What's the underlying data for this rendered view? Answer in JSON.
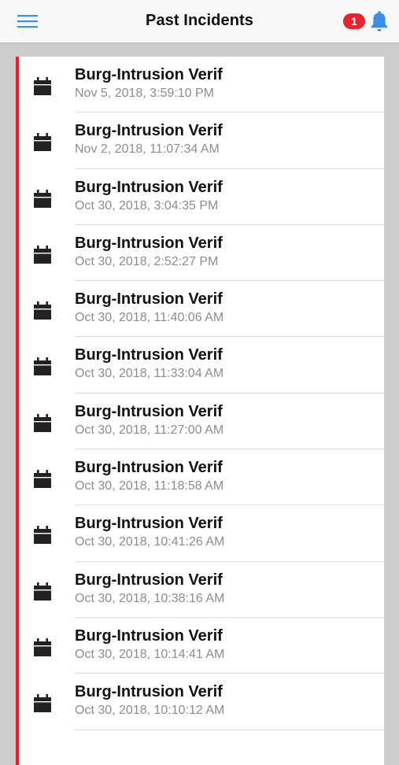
{
  "header": {
    "title": "Past Incidents",
    "notification_count": "1",
    "menu_icon": "hamburger-menu-icon",
    "bell_icon": "bell-icon",
    "accent_color": "#3a8ee6",
    "badge_color": "#e8232f"
  },
  "incidents": [
    {
      "title": "Burg-Intrusion Verif",
      "time": "Nov 5, 2018, 3:59:10 PM"
    },
    {
      "title": "Burg-Intrusion Verif",
      "time": "Nov 2, 2018, 11:07:34 AM"
    },
    {
      "title": "Burg-Intrusion Verif",
      "time": "Oct 30, 2018, 3:04:35 PM"
    },
    {
      "title": "Burg-Intrusion Verif",
      "time": "Oct 30, 2018, 2:52:27 PM"
    },
    {
      "title": "Burg-Intrusion Verif",
      "time": "Oct 30, 2018, 11:40:06 AM"
    },
    {
      "title": "Burg-Intrusion Verif",
      "time": "Oct 30, 2018, 11:33:04 AM"
    },
    {
      "title": "Burg-Intrusion Verif",
      "time": "Oct 30, 2018, 11:27:00 AM"
    },
    {
      "title": "Burg-Intrusion Verif",
      "time": "Oct 30, 2018, 11:18:58 AM"
    },
    {
      "title": "Burg-Intrusion Verif",
      "time": "Oct 30, 2018, 10:41:26 AM"
    },
    {
      "title": "Burg-Intrusion Verif",
      "time": "Oct 30, 2018, 10:38:16 AM"
    },
    {
      "title": "Burg-Intrusion Verif",
      "time": "Oct 30, 2018, 10:14:41 AM"
    },
    {
      "title": "Burg-Intrusion Verif",
      "time": "Oct 30, 2018, 10:10:12 AM"
    }
  ],
  "list_style": {
    "row_icon": "calendar-icon",
    "indicator_color": "#ee1c25"
  }
}
